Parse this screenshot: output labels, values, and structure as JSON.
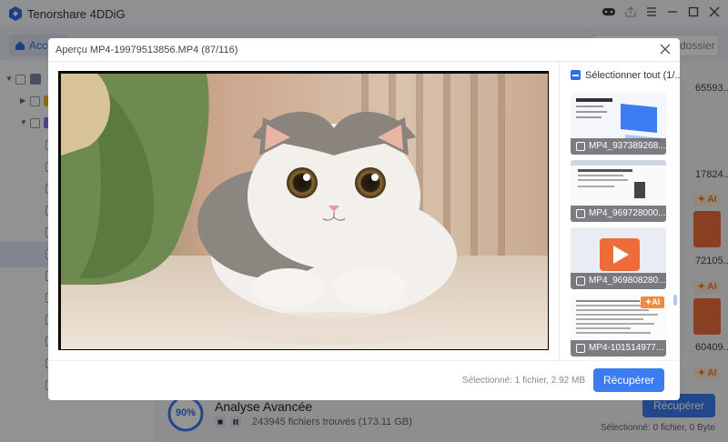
{
  "app": {
    "title": "Tenorshare 4DDiG",
    "home_tab": "Accueil",
    "folder_button": "dossier",
    "right_strip": [
      {
        "text": "65593..."
      },
      {
        "text": "17824..."
      },
      {
        "text": "72105..."
      },
      {
        "text": "60409..."
      }
    ],
    "ai_badge_label": "AI"
  },
  "bottom": {
    "progress": "90%",
    "progress_value": 0.9,
    "scan_title": "Analyse Avancée",
    "scan_count": "243945 fichiers trouvés (173.11 GB)",
    "recover_label": "Récupérer",
    "selected_text": "Sélectionné: 0 fichier, 0 Byte"
  },
  "modal": {
    "title": "Aperçu MP4-19979513856.MP4 (87/116)",
    "select_all": "Sélectionner tout (1/...",
    "thumbnails": [
      {
        "caption": "MP4_937389268...",
        "kind": "doc-blue",
        "ai": ""
      },
      {
        "caption": "MP4_969728000...",
        "kind": "doc-web",
        "ai": ""
      },
      {
        "caption": "MP4_969808280...",
        "kind": "video",
        "ai": ""
      },
      {
        "caption": "MP4-101514977...",
        "kind": "doc-text",
        "ai": "AI"
      }
    ],
    "footer_status": "Sélectionné: 1 fichier, 2.92 MB",
    "recover_label": "Récupérer"
  },
  "colors": {
    "accent": "#3b7cf0",
    "ai_orange": "#f08a3c"
  }
}
